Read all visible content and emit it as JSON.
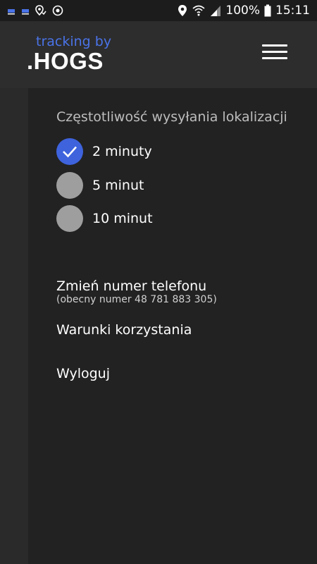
{
  "status_bar": {
    "battery_text": "100%",
    "time": "15:11",
    "icons": [
      "notification-icon",
      "notification-icon",
      "location-check-icon",
      "sync-icon",
      "location-pin-icon",
      "wifi-icon",
      "signal-icon",
      "battery-icon"
    ]
  },
  "header": {
    "logo_small": "tracking by",
    "logo_big": ".HOGS",
    "menu_icon": "hamburger-menu-icon"
  },
  "settings": {
    "frequency_title": "Częstotliwość wysyłania lokalizacji",
    "options": [
      {
        "label": "2 minuty",
        "selected": true
      },
      {
        "label": "5 minut",
        "selected": false
      },
      {
        "label": "10 minut",
        "selected": false
      }
    ],
    "change_phone_label": "Zmień numer telefonu",
    "current_number_text": "(obecny numer 48 781 883 305)",
    "terms_label": "Warunki korzystania",
    "logout_label": "Wyloguj"
  },
  "colors": {
    "accent": "#3e63dd",
    "logo_blue": "#4a73e8",
    "radio_off": "#9e9e9e",
    "panel_bg": "#222222",
    "header_bg": "#2d2d2d"
  }
}
